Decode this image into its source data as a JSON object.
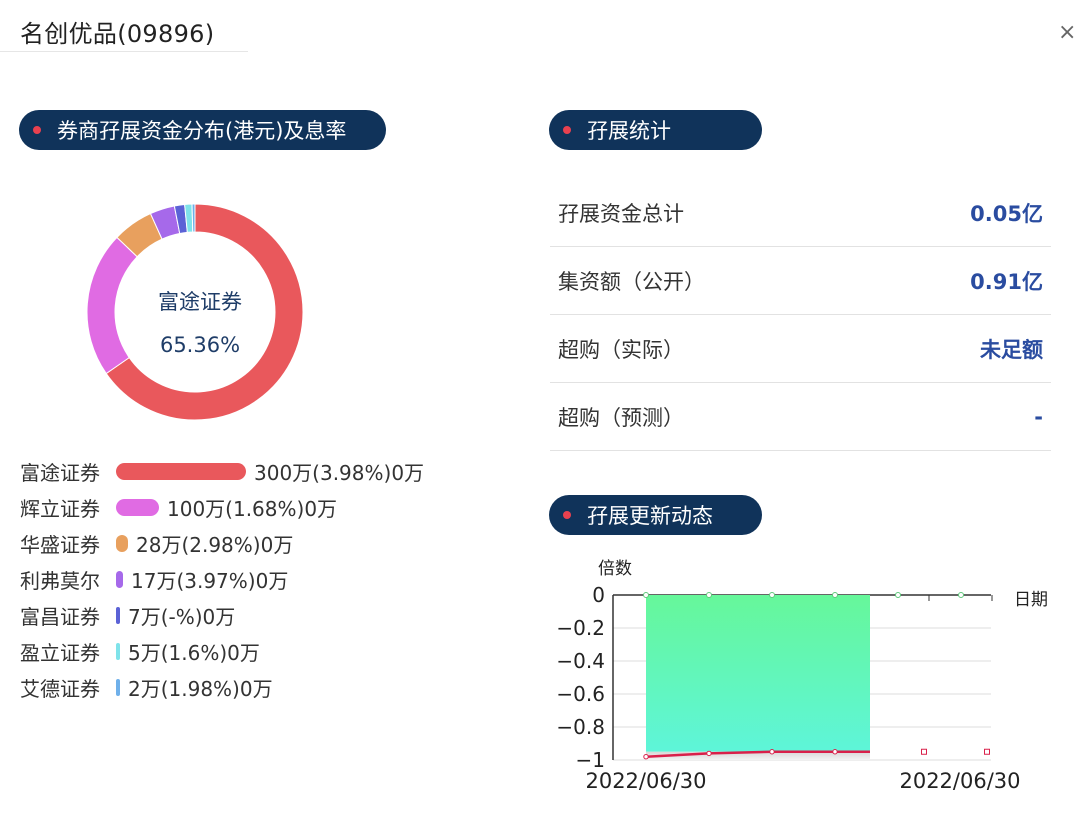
{
  "header": {
    "title": "名创优品(09896)",
    "close_icon": "×"
  },
  "sections": {
    "distribution": "券商孖展资金分布(港元)及息率",
    "stats": "孖展统计",
    "trend": "孖展更新动态"
  },
  "donut": {
    "center_name": "富途证券",
    "center_pct": "65.36%"
  },
  "brokers": [
    {
      "name": "富途证券",
      "info": "300万(3.98%)0万",
      "color": "#e9585c",
      "share": 0.6536
    },
    {
      "name": "辉立证券",
      "info": "100万(1.68%)0万",
      "color": "#e06be3",
      "share": 0.2179
    },
    {
      "name": "华盛证券",
      "info": "28万(2.98%)0万",
      "color": "#e8a05e",
      "share": 0.061
    },
    {
      "name": "利弗莫尔",
      "info": "17万(3.97%)0万",
      "color": "#a669ea",
      "share": 0.037
    },
    {
      "name": "富昌证券",
      "info": "7万(-%)0万",
      "color": "#5b62d6",
      "share": 0.0153
    },
    {
      "name": "盈立证券",
      "info": "5万(1.6%)0万",
      "color": "#7fe3ea",
      "share": 0.0109
    },
    {
      "name": "艾德证券",
      "info": "2万(1.98%)0万",
      "color": "#6fb0ea",
      "share": 0.0044
    }
  ],
  "stats": [
    {
      "label": "孖展资金总计",
      "value": "0.05亿"
    },
    {
      "label": "集资额（公开）",
      "value": "0.91亿"
    },
    {
      "label": "超购（实际）",
      "value": "未足额"
    },
    {
      "label": "超购（预测）",
      "value": "-"
    }
  ],
  "chart_data": {
    "type": "line",
    "ylabel": "倍数",
    "xlabel": "日期",
    "ylim": [
      -1,
      0
    ],
    "y_ticks": [
      "0",
      "−0.2",
      "−0.4",
      "−0.6",
      "−0.8",
      "−1"
    ],
    "x_tick_labels": [
      "2022/06/30",
      "2022/06/30"
    ],
    "grid": true,
    "series": [
      {
        "color": "#5ef590",
        "values": [
          0,
          0,
          0,
          0,
          0,
          0
        ]
      },
      {
        "color": "#d9204a",
        "values": [
          -0.98,
          -0.96,
          -0.95,
          -0.95,
          -0.95,
          -0.95
        ]
      }
    ],
    "colors": {
      "area_top": "#66f79a",
      "area_bottom": "#5ef5d9",
      "line": "#d9204a"
    }
  }
}
